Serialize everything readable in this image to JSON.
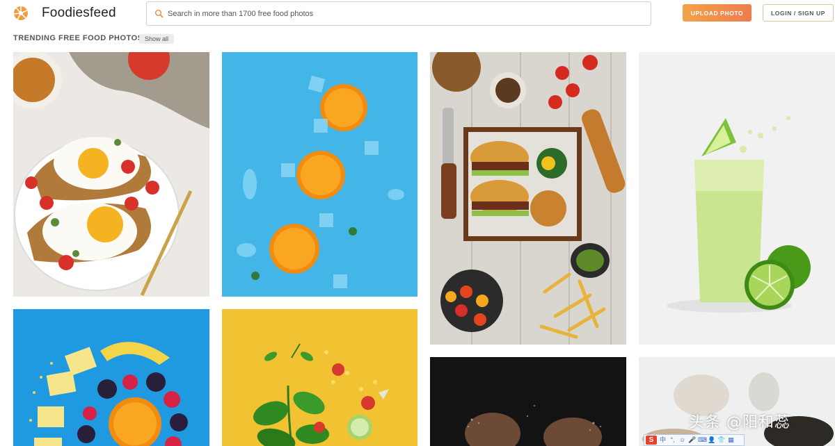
{
  "header": {
    "brand": "Foodiesfeed",
    "search_placeholder": "Search in more than 1700 free food photos",
    "upload_label": "UPLOAD PHOTO",
    "login_label": "LOGIN / SIGN UP"
  },
  "section": {
    "title": "TRENDING FREE FOOD PHOTOS",
    "show_all": "Show all"
  },
  "photos": [
    {
      "alt": "Fried eggs on avocado toast"
    },
    {
      "alt": "Orange slices on blue background"
    },
    {
      "alt": "Burgers with fries and vegetables"
    },
    {
      "alt": "Lime juice splash"
    },
    {
      "alt": "Fruit spiral on blue background"
    },
    {
      "alt": "Basil and vegetables on yellow background"
    },
    {
      "alt": "Hands with flour on dark background"
    },
    {
      "alt": "Bright table with cups"
    }
  ],
  "colors": {
    "accent_gradient_start": "#f2a34a",
    "accent_gradient_end": "#ee7c4d",
    "login_border": "#e0c29b"
  },
  "overlay": {
    "watermark": "头条 @阳和蕊",
    "ime_label": "S",
    "ime_items": [
      "中",
      "°,",
      "☺",
      "🎤",
      "⌨",
      "👤",
      "👕",
      "▦"
    ]
  }
}
